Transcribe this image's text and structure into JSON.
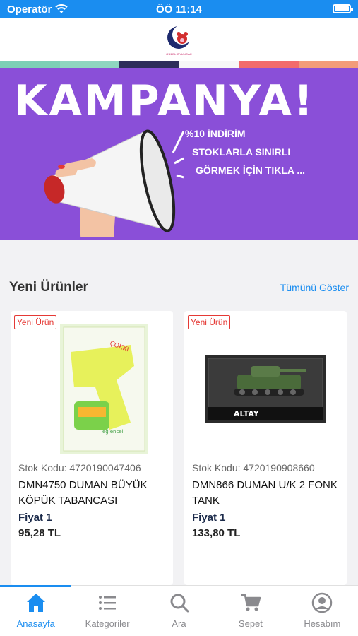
{
  "status_bar": {
    "carrier": "Operatör",
    "time": "ÖÖ 11:14"
  },
  "header": {
    "logo_text": "GÜZEL OYUNCAK"
  },
  "banner": {
    "title": "KAMPANYA!",
    "lines": [
      "%10 İNDİRİM",
      "STOKLARLA SINIRLI",
      "GÖRMEK İÇİN TIKLA ..."
    ]
  },
  "section": {
    "title": "Yeni Ürünler",
    "show_all": "Tümünü Göster"
  },
  "products": [
    {
      "badge": "Yeni Ürün",
      "stock": "Stok Kodu: 4720190047406",
      "name": "DMN4750 DUMAN BÜYÜK KÖPÜK TABANCASI",
      "price_label": "Fiyat 1",
      "price": "95,28 TL"
    },
    {
      "badge": "Yeni Ürün",
      "stock": "Stok Kodu: 4720190908660",
      "name": "DMN866 DUMAN U/K 2 FONK TANK",
      "price_label": "Fiyat 1",
      "price": "133,80 TL"
    }
  ],
  "tabs": [
    {
      "label": "Anasayfa",
      "icon": "home-icon"
    },
    {
      "label": "Kategoriler",
      "icon": "list-icon"
    },
    {
      "label": "Ara",
      "icon": "search-icon"
    },
    {
      "label": "Sepet",
      "icon": "cart-icon"
    },
    {
      "label": "Hesabım",
      "icon": "account-icon"
    }
  ],
  "colors": {
    "accent": "#1a8df0",
    "banner": "#8a4fd8",
    "badge": "#e53935",
    "stripe": [
      "#7dcfb6",
      "#7dcfb6",
      "#2d2d5a",
      "#ffffff",
      "#f26b6b",
      "#f39c7a"
    ]
  }
}
